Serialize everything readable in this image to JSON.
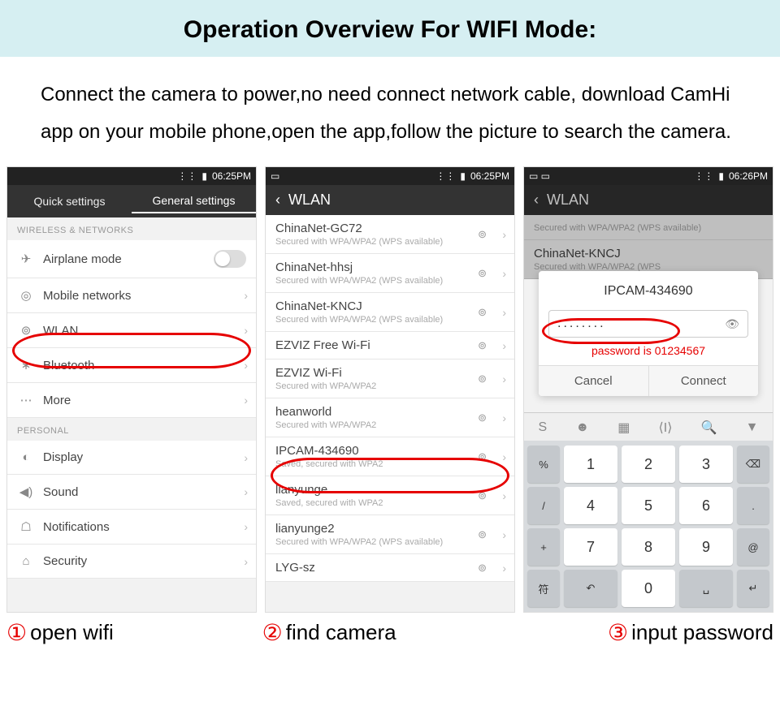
{
  "header": {
    "title": "Operation Overview For WIFI Mode:",
    "instructions": "Connect the camera to power,no need connect network cable, download CamHi app on your mobile phone,open the app,follow the picture to search the camera."
  },
  "phone1": {
    "status_time": "06:25PM",
    "tabs": {
      "quick": "Quick settings",
      "general": "General settings"
    },
    "section1": "WIRELESS & NETWORKS",
    "rows1": [
      {
        "icon": "✈",
        "label": "Airplane mode"
      },
      {
        "icon": "◎",
        "label": "Mobile networks"
      },
      {
        "icon": "⊚",
        "label": "WLAN"
      },
      {
        "icon": "∗",
        "label": "Bluetooth"
      },
      {
        "icon": "⋯",
        "label": "More"
      }
    ],
    "section2": "PERSONAL",
    "rows2": [
      {
        "icon": "◐",
        "label": "Display"
      },
      {
        "icon": "◀)",
        "label": "Sound"
      },
      {
        "icon": "☖",
        "label": "Notifications"
      },
      {
        "icon": "⌂",
        "label": "Security"
      }
    ]
  },
  "phone2": {
    "status_time": "06:25PM",
    "title": "WLAN",
    "networks": [
      {
        "name": "ChinaNet-GC72",
        "sub": "Secured with WPA/WPA2 (WPS available)"
      },
      {
        "name": "ChinaNet-hhsj",
        "sub": "Secured with WPA/WPA2 (WPS available)"
      },
      {
        "name": "ChinaNet-KNCJ",
        "sub": "Secured with WPA/WPA2 (WPS available)"
      },
      {
        "name": "EZVIZ Free Wi-Fi",
        "sub": ""
      },
      {
        "name": "EZVIZ Wi-Fi",
        "sub": "Secured with WPA/WPA2"
      },
      {
        "name": "heanworld",
        "sub": "Secured with WPA/WPA2"
      },
      {
        "name": "IPCAM-434690",
        "sub": "Saved, secured with WPA2"
      },
      {
        "name": "lianyunge",
        "sub": "Saved, secured with WPA2"
      },
      {
        "name": "lianyunge2",
        "sub": "Secured with WPA/WPA2 (WPS available)"
      },
      {
        "name": "LYG-sz",
        "sub": ""
      }
    ]
  },
  "phone3": {
    "status_time": "06:26PM",
    "title": "WLAN",
    "bg_net1": {
      "sub": "Secured with WPA/WPA2 (WPS available)"
    },
    "bg_net2": {
      "name": "ChinaNet-KNCJ",
      "sub": "Secured with WPA/WPA2 (WPS"
    },
    "dialog": {
      "title": "IPCAM-434690",
      "dots": "........",
      "note": "password is 01234567",
      "cancel": "Cancel",
      "connect": "Connect"
    },
    "toolbar": [
      "S",
      "☻",
      "▦",
      "⟨I⟩",
      "🔍",
      "▼"
    ],
    "keys": {
      "r1": [
        "%",
        "1",
        "2",
        "3",
        "⌫"
      ],
      "r2": [
        "/",
        "4",
        "5",
        "6",
        "."
      ],
      "r3": [
        "+",
        "7",
        "8",
        "9",
        "@"
      ],
      "r4": [
        "符",
        "↶",
        "0",
        "␣",
        "↵"
      ]
    }
  },
  "captions": {
    "c1_num": "①",
    "c1": "open wifi",
    "c2_num": "②",
    "c2": "find camera",
    "c3_num": "③",
    "c3": "input password"
  }
}
